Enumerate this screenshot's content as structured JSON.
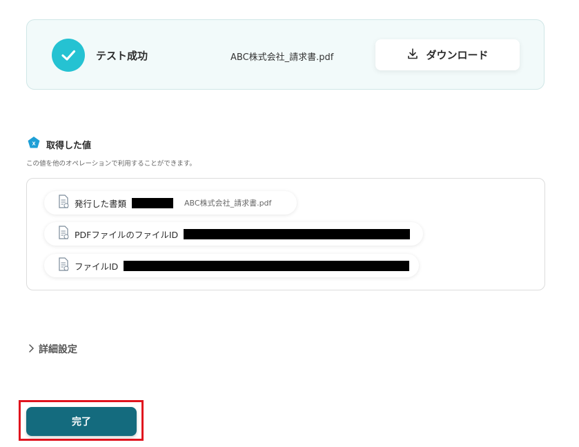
{
  "result": {
    "status_text": "テスト成功",
    "file_name": "ABC株式会社_請求書.pdf",
    "download_label": "ダウンロード"
  },
  "section": {
    "title": "取得した値",
    "description": "この値を他のオペレーションで利用することができます。"
  },
  "values": [
    {
      "label": "発行した書類",
      "value": "ABC株式会社_請求書.pdf",
      "redacted": true
    },
    {
      "label": "PDFファイルのファイルID",
      "value": "",
      "redacted": true
    },
    {
      "label": "ファイルID",
      "value": "",
      "redacted": true
    }
  ],
  "advanced": {
    "label": "詳細設定"
  },
  "footer": {
    "complete_label": "完了"
  },
  "colors": {
    "accent": "#25c2d2",
    "primary": "#146b7e",
    "highlight": "#e0141e"
  },
  "icons": [
    "check-icon",
    "download-icon",
    "variable-icon",
    "document-icon",
    "chevron-right-icon"
  ]
}
